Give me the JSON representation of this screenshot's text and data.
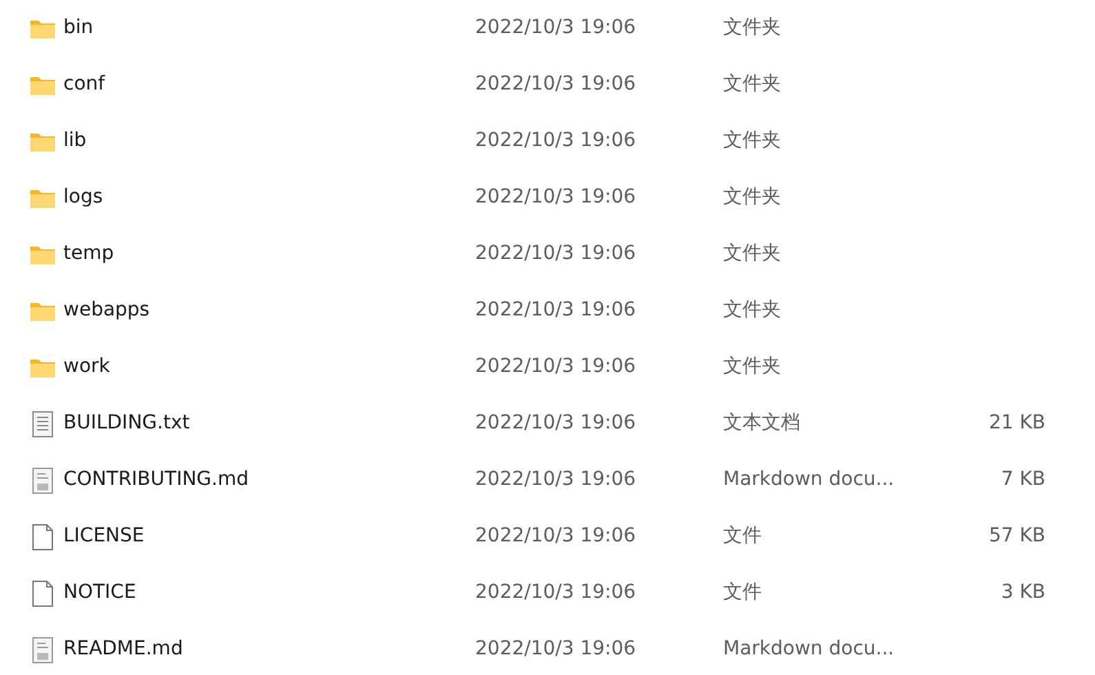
{
  "files": [
    {
      "name": "bin",
      "kind": "folder",
      "modified": "2022/10/3 19:06",
      "type": "文件夹"
    },
    {
      "name": "conf",
      "kind": "folder",
      "modified": "2022/10/3 19:06",
      "type": "文件夹"
    },
    {
      "name": "lib",
      "kind": "folder",
      "modified": "2022/10/3 19:06",
      "type": "文件夹"
    },
    {
      "name": "logs",
      "kind": "folder",
      "modified": "2022/10/3 19:06",
      "type": "文件夹"
    },
    {
      "name": "temp",
      "kind": "folder",
      "modified": "2022/10/3 19:06",
      "type": "文件夹"
    },
    {
      "name": "webapps",
      "kind": "folder",
      "modified": "2022/10/3 19:06",
      "type": "文件夹"
    },
    {
      "name": "work",
      "kind": "folder",
      "modified": "2022/10/3 19:06",
      "type": "文件夹"
    },
    {
      "name": "BUILDING.txt",
      "kind": "text",
      "modified": "2022/10/3 19:06",
      "type": "文本文档",
      "size": "21 KB"
    },
    {
      "name": "CONTRIBUTING.md",
      "kind": "markdown",
      "modified": "2022/10/3 19:06",
      "type": "Markdown docu...",
      "size": "7 KB"
    },
    {
      "name": "LICENSE",
      "kind": "blank",
      "modified": "2022/10/3 19:06",
      "type": "文件",
      "size": "57 KB"
    },
    {
      "name": "NOTICE",
      "kind": "blank",
      "modified": "2022/10/3 19:06",
      "type": "文件",
      "size": "3 KB"
    },
    {
      "name": "README.md",
      "kind": "markdown",
      "modified": "2022/10/3 19:06",
      "type": "Markdown docu..."
    }
  ]
}
